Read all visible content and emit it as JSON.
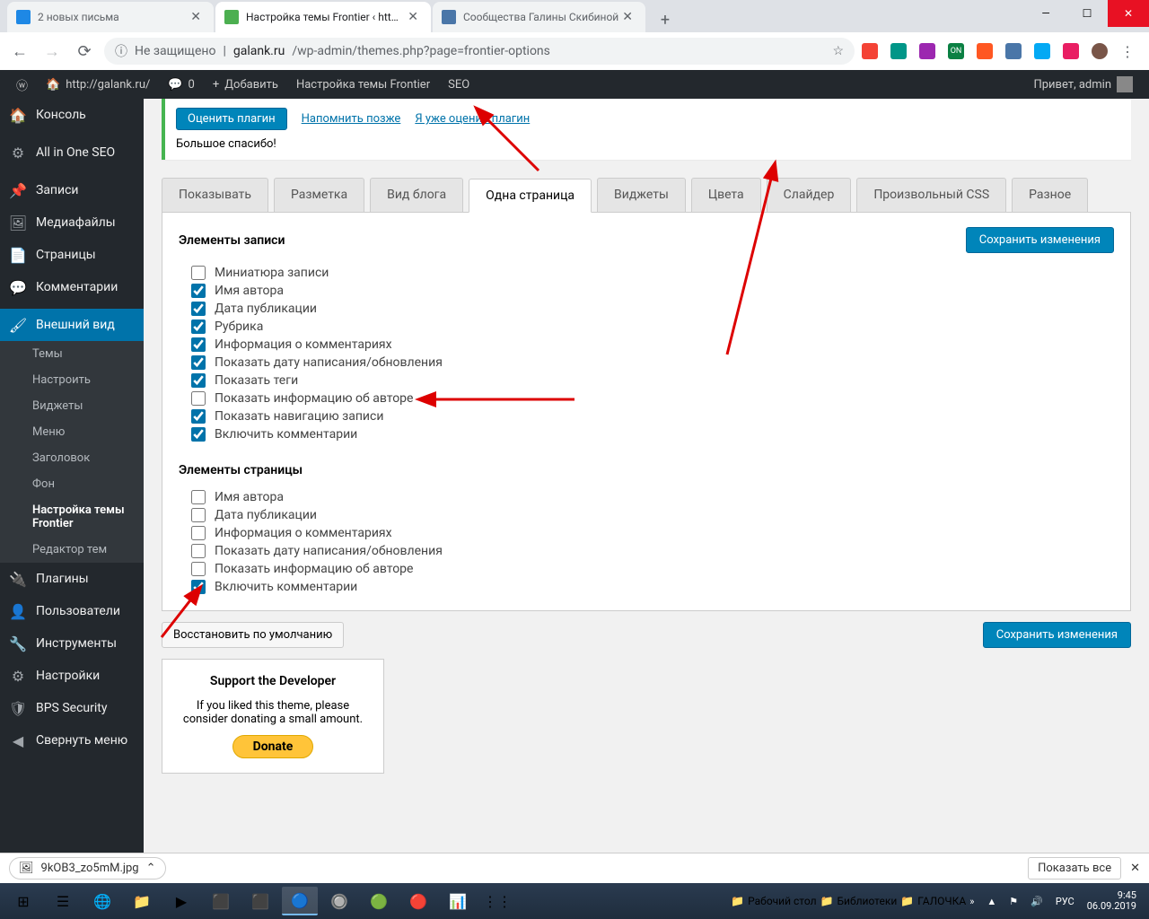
{
  "browser": {
    "tabs": [
      {
        "title": "2 новых письма",
        "favicon": "#1e88e5"
      },
      {
        "title": "Настройка темы Frontier ‹ http:/",
        "favicon": "#4caf50"
      },
      {
        "title": "Сообщества Галины Скибиной",
        "favicon": "#4a76a8"
      }
    ],
    "url_unsecure": "Не защищено",
    "url_host": "galank.ru",
    "url_path": "/wp-admin/themes.php?page=frontier-options"
  },
  "adminbar": {
    "site": "http://galank.ru/",
    "comments": "0",
    "add": "Добавить",
    "theme": "Настройка темы Frontier",
    "seo": "SEO",
    "greeting": "Привет, admin"
  },
  "sidebar": {
    "items": [
      {
        "icon": "🏠",
        "label": "Консоль"
      },
      {
        "icon": "⚙",
        "label": "All in One SEO"
      },
      {
        "icon": "📌",
        "label": "Записи"
      },
      {
        "icon": "🖼",
        "label": "Медиафайлы"
      },
      {
        "icon": "📄",
        "label": "Страницы"
      },
      {
        "icon": "💬",
        "label": "Комментарии"
      },
      {
        "icon": "🖌",
        "label": "Внешний вид",
        "current": true
      },
      {
        "icon": "🔌",
        "label": "Плагины"
      },
      {
        "icon": "👤",
        "label": "Пользователи"
      },
      {
        "icon": "🔧",
        "label": "Инструменты"
      },
      {
        "icon": "⚙",
        "label": "Настройки"
      },
      {
        "icon": "🛡",
        "label": "BPS Security"
      },
      {
        "icon": "◀",
        "label": "Свернуть меню"
      }
    ],
    "submenu": [
      "Темы",
      "Настроить",
      "Виджеты",
      "Меню",
      "Заголовок",
      "Фон",
      "Настройка темы Frontier",
      "Редактор тем"
    ],
    "submenu_active_index": 6
  },
  "notice": {
    "rate": "Оценить плагин",
    "remind": "Напомнить позже",
    "already": "Я уже оценил плагин",
    "thanks": "Большое спасибо!"
  },
  "tabs": [
    "Показывать",
    "Разметка",
    "Вид блога",
    "Одна страница",
    "Виджеты",
    "Цвета",
    "Слайдер",
    "Произвольный CSS",
    "Разное"
  ],
  "tabs_active_index": 3,
  "section1": {
    "title": "Элементы записи",
    "save": "Сохранить изменения",
    "options": [
      {
        "label": "Миниатюра записи",
        "checked": false
      },
      {
        "label": "Имя автора",
        "checked": true
      },
      {
        "label": "Дата публикации",
        "checked": true
      },
      {
        "label": "Рубрика",
        "checked": true
      },
      {
        "label": "Информация о комментариях",
        "checked": true
      },
      {
        "label": "Показать дату написания/обновления",
        "checked": true
      },
      {
        "label": "Показать теги",
        "checked": true
      },
      {
        "label": "Показать информацию об авторе",
        "checked": false
      },
      {
        "label": "Показать навигацию записи",
        "checked": true
      },
      {
        "label": "Включить комментарии",
        "checked": true
      }
    ]
  },
  "section2": {
    "title": "Элементы страницы",
    "options": [
      {
        "label": "Имя автора",
        "checked": false
      },
      {
        "label": "Дата публикации",
        "checked": false
      },
      {
        "label": "Информация о комментариях",
        "checked": false
      },
      {
        "label": "Показать дату написания/обновления",
        "checked": false
      },
      {
        "label": "Показать информацию об авторе",
        "checked": false
      },
      {
        "label": "Включить комментарии",
        "checked": true
      }
    ]
  },
  "footer": {
    "restore": "Восстановить по умолчанию",
    "save": "Сохранить изменения"
  },
  "support": {
    "title": "Support the Developer",
    "text": "If you liked this theme, please consider donating a small amount.",
    "donate": "Donate"
  },
  "download": {
    "file": "9kOB3_zo5mM.jpg",
    "show_all": "Показать все"
  },
  "tray": {
    "folders": [
      "Рабочий стол",
      "Библиотеки",
      "ГАЛОЧКА"
    ],
    "lang": "РУС",
    "time": "9:45",
    "date": "06.09.2019"
  }
}
